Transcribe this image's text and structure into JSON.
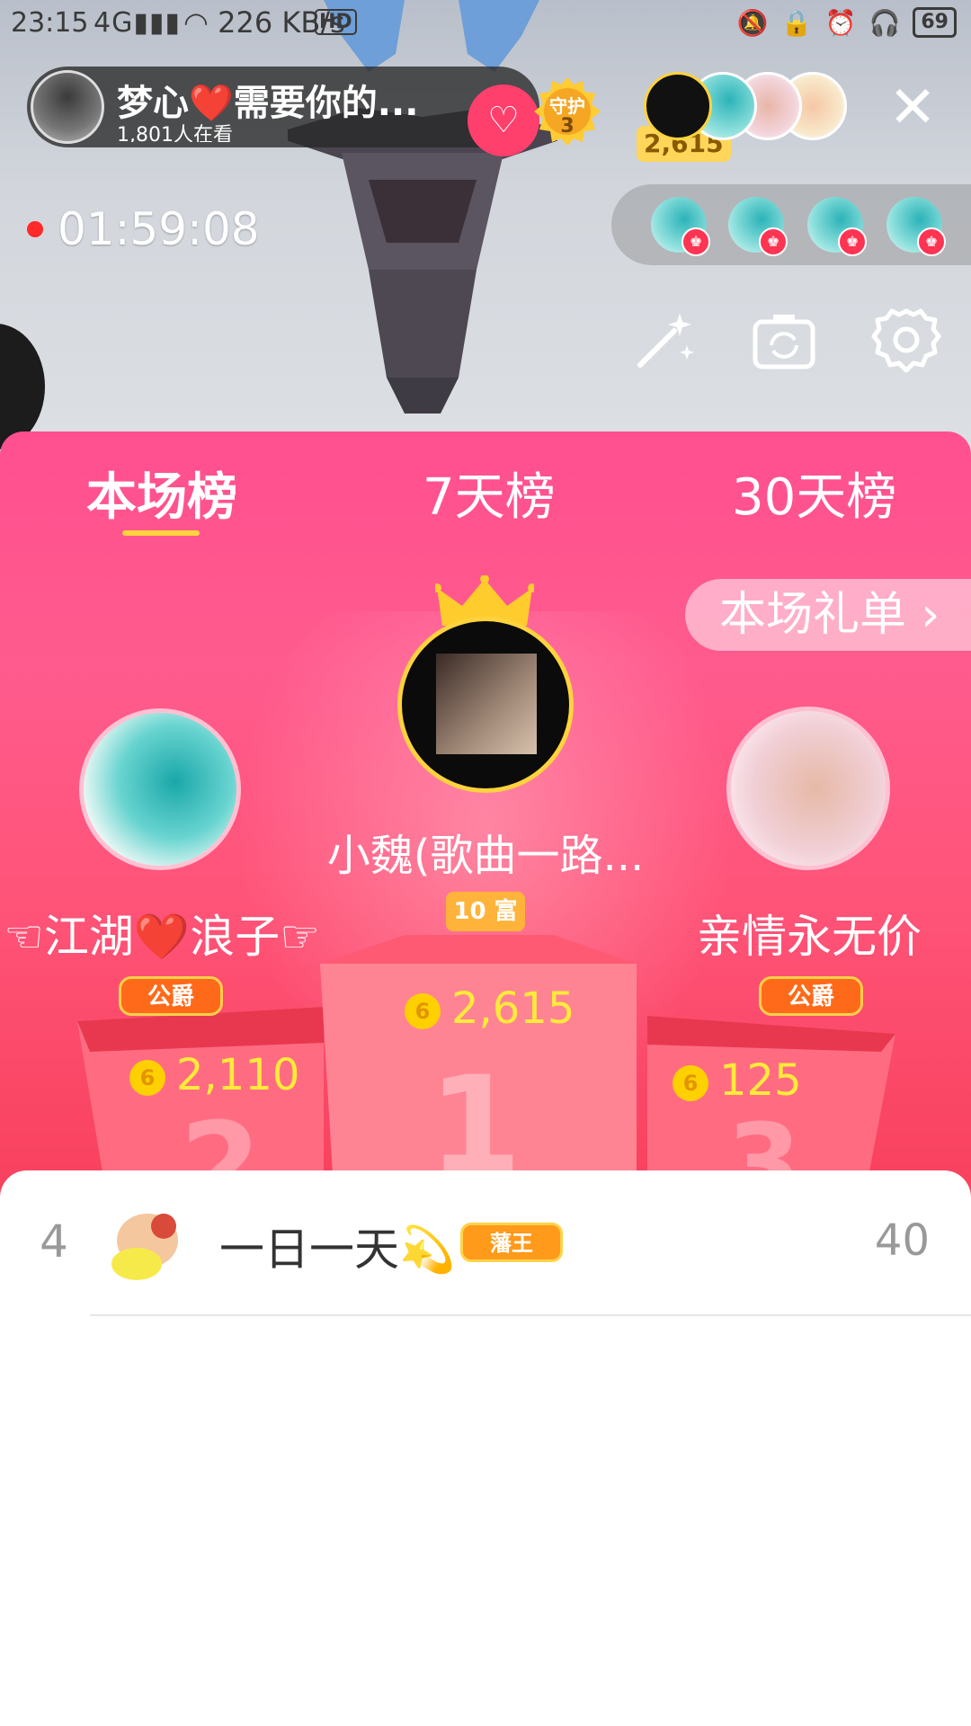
{
  "status_bar": {
    "time": "23:15",
    "network": "4G",
    "speed": "226 KB/s",
    "hd": "HD",
    "battery": "69"
  },
  "host": {
    "name": "梦心❤️需要你的...",
    "viewers": "1,801人在看",
    "follow_icon": "heart-plus-icon",
    "guard_label": "守护",
    "guard_count": "3"
  },
  "top_contributor_score": "2,615",
  "live_timer": "01:59:08",
  "tools": [
    "magic-wand-icon",
    "flip-camera-icon",
    "settings-gear-icon"
  ],
  "tabs": [
    {
      "label": "本场榜",
      "active": true
    },
    {
      "label": "7天榜",
      "active": false
    },
    {
      "label": "30天榜",
      "active": false
    }
  ],
  "gift_list_button": "本场礼单 ›",
  "podium": {
    "first": {
      "name": "小魏(歌曲一路...",
      "badge": "10 富",
      "score": "2,615",
      "rank": "1"
    },
    "second": {
      "name": "☜江湖❤️浪子☞",
      "badge": "公爵",
      "score": "2,110",
      "rank": "2"
    },
    "third": {
      "name": "亲情永无价",
      "badge": "公爵",
      "score": "125",
      "rank": "3"
    }
  },
  "coin_glyph": "6",
  "list": [
    {
      "rank": "4",
      "name": "一日一天💫",
      "badge": "藩王",
      "score": "40"
    }
  ],
  "colors": {
    "panel_top": "#ff4f8f",
    "panel_bottom": "#f8405c",
    "accent_gold": "#ffd33d",
    "score_yellow": "#ffea3a"
  }
}
